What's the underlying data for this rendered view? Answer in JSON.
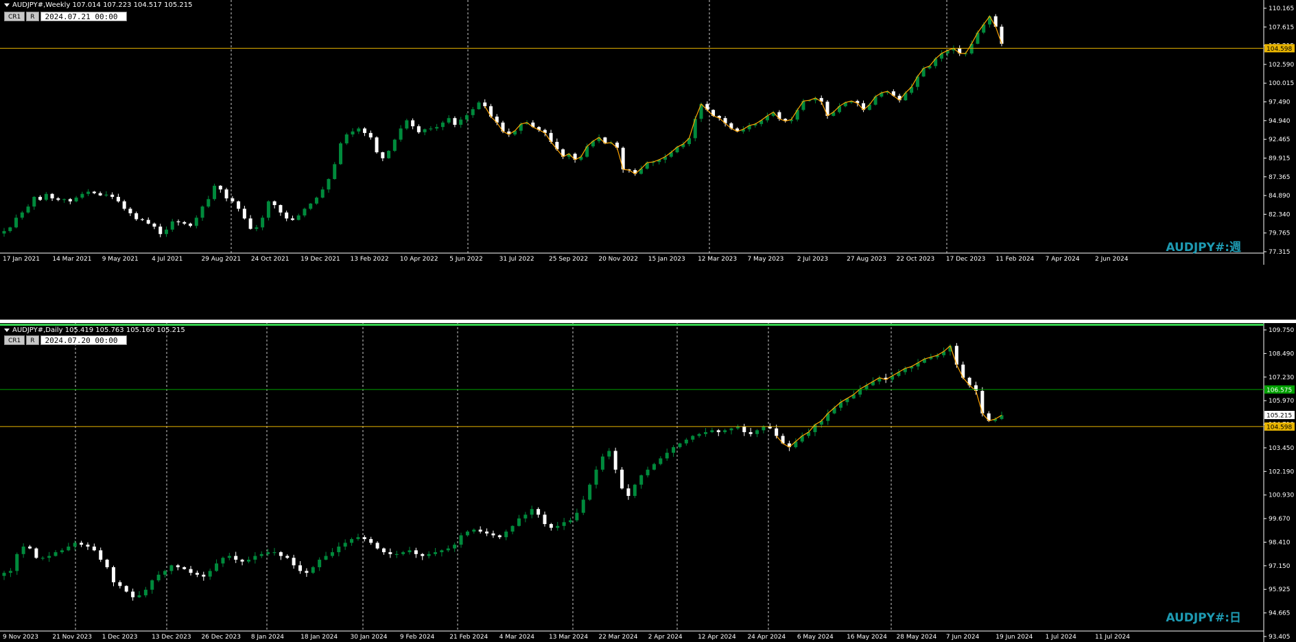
{
  "colors": {
    "background": "#000000",
    "bull": "#008a3c",
    "bear": "#ffffff",
    "level": "#e8b400",
    "level_green": "#00a000",
    "overlay": "#ffa500",
    "grid": "#ffffff",
    "watermark": "#1e9bb3"
  },
  "panels": [
    {
      "id": "weekly",
      "header": "AUDJPY#,Weekly  107.014 107.223 104.517 105.215",
      "buttons": [
        "CR1",
        "R"
      ],
      "date": "2024.07.21 00:00",
      "watermark": "AUDJPY#:週",
      "price_labels": [
        "110.165",
        "107.615",
        "105.215",
        "102.590",
        "100.015",
        "97.490",
        "94.940",
        "92.465",
        "89.915",
        "87.365",
        "84.890",
        "82.340",
        "79.765",
        "77.315"
      ],
      "level_labels": [
        "104.598"
      ],
      "x_labels": [
        "17 Jan 2021",
        "14 Mar 2021",
        "9 May 2021",
        "4 Jul 2021",
        "29 Aug 2021",
        "24 Oct 2021",
        "19 Dec 2021",
        "13 Feb 2022",
        "10 Apr 2022",
        "5 Jun 2022",
        "31 Jul 2022",
        "25 Sep 2022",
        "20 Nov 2022",
        "15 Jan 2023",
        "12 Mar 2023",
        "7 May 2023",
        "2 Jul 2023",
        "27 Aug 2023",
        "22 Oct 2023",
        "17 Dec 2023",
        "11 Feb 2024",
        "7 Apr 2024",
        "2 Jun 2024"
      ]
    },
    {
      "id": "daily",
      "header": "AUDJPY#,Daily  105.419 105.763 105.160 105.215",
      "buttons": [
        "CR1",
        "R"
      ],
      "date": "2024.07.20 00:00",
      "watermark": "AUDJPY#:日",
      "price_labels": [
        "109.750",
        "108.490",
        "107.230",
        "105.970",
        "104.710",
        "103.450",
        "102.190",
        "100.930",
        "99.670",
        "98.410",
        "97.150",
        "95.925",
        "94.665",
        "93.405"
      ],
      "level_labels": [
        "106.575",
        "105.215",
        "104.598"
      ],
      "x_labels": [
        "9 Nov 2023",
        "21 Nov 2023",
        "1 Dec 2023",
        "13 Dec 2023",
        "26 Dec 2023",
        "8 Jan 2024",
        "18 Jan 2024",
        "30 Jan 2024",
        "9 Feb 2024",
        "21 Feb 2024",
        "4 Mar 2024",
        "13 Mar 2024",
        "22 Mar 2024",
        "2 Apr 2024",
        "12 Apr 2024",
        "24 Apr 2024",
        "6 May 2024",
        "16 May 2024",
        "28 May 2024",
        "7 Jun 2024",
        "19 Jun 2024",
        "1 Jul 2024",
        "11 Jul 2024"
      ]
    }
  ],
  "chart_data": [
    {
      "type": "candlestick",
      "title": "AUDJPY#,Weekly",
      "ylim": [
        77.315,
        110.165
      ],
      "levels": [
        104.598
      ],
      "close_series": [
        80.0,
        80.5,
        81.8,
        82.5,
        83.3,
        84.6,
        84.2,
        85.0,
        84.4,
        84.2,
        84.3,
        84.0,
        84.5,
        85.0,
        85.3,
        85.1,
        84.8,
        84.9,
        84.6,
        84.0,
        83.0,
        82.4,
        81.6,
        81.5,
        81.0,
        80.6,
        79.6,
        80.2,
        81.3,
        81.2,
        81.0,
        80.7,
        81.8,
        83.3,
        84.3,
        86.1,
        85.6,
        84.4,
        84.0,
        83.0,
        81.7,
        80.3,
        80.5,
        81.8,
        84.0,
        83.5,
        82.5,
        81.7,
        81.5,
        82.1,
        83.0,
        83.7,
        84.5,
        85.6,
        87.0,
        89.0,
        91.8,
        93.0,
        93.4,
        93.8,
        93.2,
        92.6,
        90.6,
        89.8,
        90.8,
        92.3,
        93.8,
        94.9,
        94.1,
        93.3,
        93.7,
        93.8,
        94.0,
        94.6,
        95.2,
        94.3,
        95.0,
        95.6,
        96.4,
        97.3,
        96.8,
        95.4,
        94.6,
        93.4,
        93.0,
        93.5,
        94.4,
        94.6,
        94.0,
        93.6,
        93.2,
        92.0,
        91.0,
        90.0,
        90.4,
        89.6,
        90.0,
        91.4,
        92.1,
        92.6,
        91.8,
        91.9,
        91.2,
        88.3,
        88.2,
        87.7,
        88.4,
        89.2,
        89.3,
        89.6,
        90.0,
        90.6,
        91.3,
        91.7,
        92.5,
        95.1,
        97.1,
        96.3,
        95.5,
        95.2,
        94.5,
        93.8,
        93.4,
        93.7,
        94.2,
        94.4,
        94.9,
        95.5,
        96.0,
        95.1,
        94.8,
        95.0,
        96.3,
        97.5,
        97.6,
        97.9,
        97.4,
        95.5,
        96.0,
        96.8,
        97.3,
        97.5,
        97.2,
        96.3,
        97.0,
        98.1,
        98.6,
        98.8,
        98.2,
        97.6,
        98.6,
        99.4,
        100.8,
        101.9,
        102.2,
        103.2,
        103.9,
        104.3,
        104.6,
        103.9,
        103.9,
        105.2,
        106.7,
        107.8,
        108.9,
        107.5,
        105.2
      ]
    },
    {
      "type": "candlestick",
      "title": "AUDJPY#,Daily",
      "ylim": [
        93.405,
        109.75
      ],
      "levels": [
        106.575,
        105.215,
        104.598
      ],
      "close_series": [
        96.8,
        96.9,
        97.8,
        98.2,
        98.1,
        97.6,
        97.6,
        97.7,
        97.9,
        98.0,
        98.2,
        98.4,
        98.3,
        98.2,
        98.0,
        97.5,
        97.1,
        96.3,
        96.1,
        95.8,
        95.5,
        95.6,
        95.9,
        96.4,
        96.7,
        96.9,
        97.2,
        97.1,
        97.0,
        96.8,
        96.7,
        96.6,
        96.9,
        97.3,
        97.6,
        97.7,
        97.5,
        97.4,
        97.5,
        97.7,
        97.8,
        97.9,
        97.9,
        97.7,
        97.6,
        97.2,
        96.9,
        96.8,
        97.1,
        97.5,
        97.7,
        97.9,
        98.2,
        98.4,
        98.6,
        98.7,
        98.6,
        98.4,
        98.1,
        97.9,
        97.8,
        97.8,
        97.9,
        98.0,
        97.8,
        97.7,
        97.8,
        97.9,
        98.0,
        98.1,
        98.3,
        98.8,
        99.0,
        99.1,
        99.0,
        98.9,
        98.8,
        98.7,
        99.0,
        99.3,
        99.7,
        99.9,
        100.2,
        99.9,
        99.4,
        99.2,
        99.3,
        99.5,
        99.6,
        100.0,
        100.7,
        101.5,
        102.3,
        103.0,
        103.3,
        102.3,
        101.3,
        100.9,
        101.5,
        102.0,
        102.3,
        102.6,
        102.9,
        103.2,
        103.5,
        103.7,
        103.9,
        104.1,
        104.2,
        104.3,
        104.4,
        104.3,
        104.4,
        104.5,
        104.6,
        104.3,
        104.2,
        104.4,
        104.6,
        104.5,
        104.1,
        103.7,
        103.5,
        103.8,
        104.1,
        104.3,
        104.7,
        104.9,
        105.3,
        105.6,
        105.9,
        106.1,
        106.3,
        106.6,
        106.8,
        107.0,
        107.2,
        107.1,
        107.3,
        107.5,
        107.7,
        107.8,
        108.0,
        108.2,
        108.3,
        108.4,
        108.6,
        108.9,
        107.9,
        107.2,
        106.8,
        106.5,
        105.3,
        104.9,
        105.0,
        105.2
      ]
    }
  ]
}
